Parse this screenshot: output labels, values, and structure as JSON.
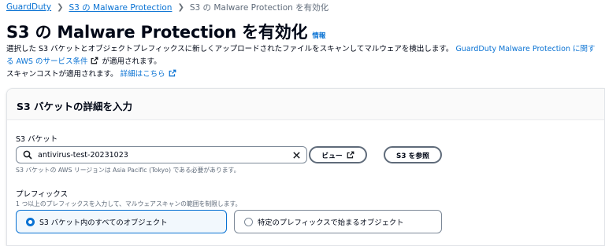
{
  "breadcrumb": {
    "items": [
      "GuardDuty",
      "S3 の Malware Protection",
      "S3 の Malware Protection を有効化"
    ]
  },
  "header": {
    "title": "S3 の Malware Protection を有効化",
    "info": "情報"
  },
  "description": {
    "text_before": "選択した S3 バケットとオブジェクトプレフィックスに新しくアップロードされたファイルをスキャンしてマルウェアを検出します。",
    "terms_link": "GuardDuty Malware Protection に関する AWS のサービス条件",
    "text_after": "が適用されます。"
  },
  "cost": {
    "text": "スキャンコストが適用されます。",
    "details_link": "詳細はこちら"
  },
  "panel": {
    "title": "S3 バケットの詳細を入力",
    "bucket": {
      "label": "S3 バケット",
      "value": "antivirus-test-20231023",
      "hint": "S3 バケットの AWS リージョンは Asia Pacific (Tokyo) である必要があります。",
      "view_button": "ビュー",
      "browse_button": "S3 を参照"
    },
    "prefix": {
      "label": "プレフィックス",
      "hint": "1 つ以上のプレフィックスを入力して、マルウェアスキャンの範囲を制限します。",
      "options": [
        "S3 バケット内のすべてのオブジェクト",
        "特定のプレフィックスで始まるオブジェクト"
      ],
      "selected_index": 0
    }
  },
  "icons": {
    "external": "external-link-icon",
    "search": "search-icon",
    "clear": "close-icon"
  },
  "colors": {
    "link": "#0972d3",
    "text": "#000716",
    "secondary": "#5f6b7a",
    "selected_bg": "#f2f8fd"
  }
}
